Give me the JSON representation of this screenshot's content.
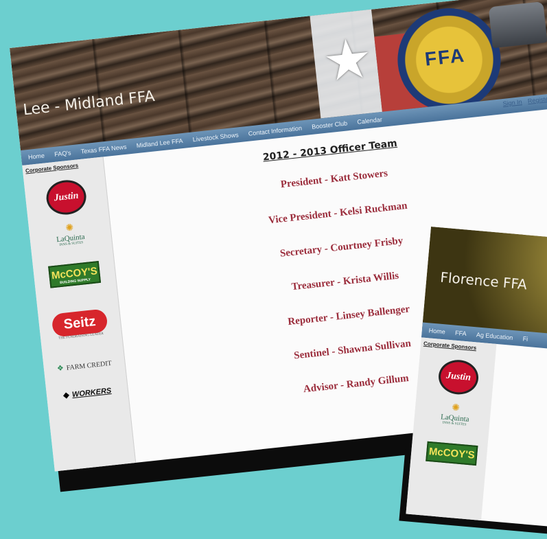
{
  "colors": {
    "background": "#6ccfcf",
    "nav": "#4a739b",
    "officer_text": "#9b2d3c"
  },
  "main_page": {
    "site_title": "Lee - Midland FFA",
    "emblem_text": "FFA",
    "nav_items": [
      "Home",
      "FAQ's",
      "Texas FFA News",
      "Midland Lee FFA",
      "Livestock Shows",
      "Contact Information",
      "Booster Club",
      "Calendar"
    ],
    "auth": {
      "sign_in": "Sign In",
      "register": "Register"
    },
    "sidebar": {
      "title": "Corporate Sponsors",
      "sponsors": [
        "Justin",
        "LaQuinta",
        "McCOY'S",
        "Seitz",
        "FARM CREDIT",
        "WORKERS"
      ],
      "sponsor_sublines": {
        "laquinta": "INNS & SUITES",
        "mccoys": "BUILDING SUPPLY",
        "seitz": "THE FUNDRAISING LEADER"
      }
    },
    "officers": {
      "heading": "2012 - 2013 Officer Team",
      "list": [
        "President - Katt Stowers",
        "Vice President - Kelsi Ruckman",
        "Secretary - Courtney Frisby",
        "Treasurer - Krista Willis",
        "Reporter - Linsey Ballenger",
        "Sentinel - Shawna Sullivan",
        "Advisor - Randy Gillum"
      ]
    }
  },
  "second_page": {
    "site_title": "Florence FFA",
    "nav_items": [
      "Home",
      "FFA",
      "Ag Education",
      "Fi"
    ],
    "sidebar_title": "Corporate Sponsors",
    "sponsors": [
      "Justin",
      "LaQuinta",
      "McCOY'S"
    ],
    "sponsor_sublines": {
      "laquinta": "INNS & SUITES"
    }
  }
}
